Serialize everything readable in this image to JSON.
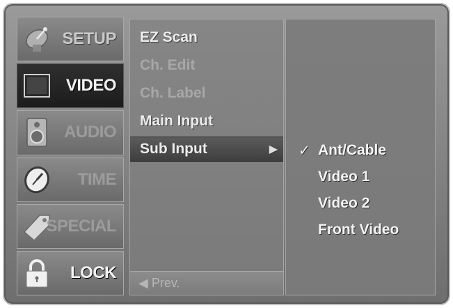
{
  "sidebar": {
    "items": [
      {
        "label": "SETUP",
        "icon": "satellite-dish-icon",
        "active": false
      },
      {
        "label": "VIDEO",
        "icon": "screen-icon",
        "active": true
      },
      {
        "label": "AUDIO",
        "icon": "speaker-icon",
        "active": false
      },
      {
        "label": "TIME",
        "icon": "clock-icon",
        "active": false
      },
      {
        "label": "SPECIAL",
        "icon": "tag-icon",
        "active": false
      },
      {
        "label": "LOCK",
        "icon": "padlock-icon",
        "active": false
      }
    ]
  },
  "submenu": {
    "items": [
      {
        "label": "EZ Scan",
        "state": "enabled"
      },
      {
        "label": "Ch. Edit",
        "state": "disabled"
      },
      {
        "label": "Ch. Label",
        "state": "disabled"
      },
      {
        "label": "Main Input",
        "state": "enabled"
      },
      {
        "label": "Sub Input",
        "state": "selected",
        "arrow": "▶"
      }
    ],
    "prev_label": "◀ Prev."
  },
  "options": {
    "items": [
      {
        "label": "Ant/Cable",
        "checked": true,
        "check_mark": "✓"
      },
      {
        "label": "Video 1",
        "checked": false
      },
      {
        "label": "Video 2",
        "checked": false
      },
      {
        "label": "Front Video",
        "checked": false
      }
    ]
  },
  "colors": {
    "frame": "#7a7a7a",
    "active_item": "#1c1c1c",
    "text_bright": "#f2f2f2",
    "text_dim": "#a8a8a8"
  }
}
